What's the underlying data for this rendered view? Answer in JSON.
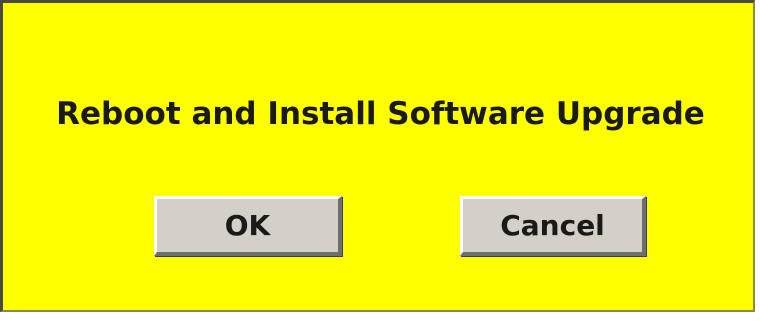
{
  "dialog": {
    "message": "Reboot and Install Software Upgrade",
    "ok_label": "OK",
    "cancel_label": "Cancel",
    "background_color": "#ffff00"
  }
}
